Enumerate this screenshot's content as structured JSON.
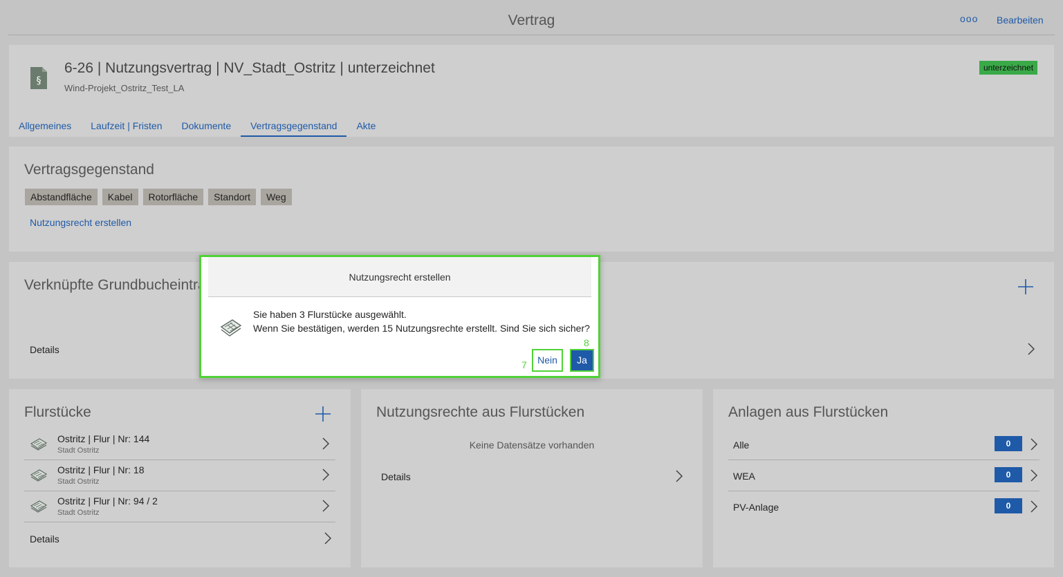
{
  "topbar": {
    "title": "Vertrag",
    "more_label": "ooo",
    "edit_label": "Bearbeiten"
  },
  "header": {
    "title": "6-26 | Nutzungsvertrag | NV_Stadt_Ostritz | unterzeichnet",
    "subtitle": "Wind-Projekt_Ostritz_Test_LA",
    "status_badge": "unterzeichnet",
    "tabs": [
      {
        "label": "Allgemeines",
        "active": false
      },
      {
        "label": "Laufzeit | Fristen",
        "active": false
      },
      {
        "label": "Dokumente",
        "active": false
      },
      {
        "label": "Vertragsgegenstand",
        "active": true
      },
      {
        "label": "Akte",
        "active": false
      }
    ]
  },
  "vertragsgegenstand": {
    "title": "Vertragsgegenstand",
    "chips": [
      "Abstandfläche",
      "Kabel",
      "Rotorfläche",
      "Standort",
      "Weg"
    ],
    "create_link": "Nutzungsrecht erstellen"
  },
  "grundbuch": {
    "title": "Verknüpfte Grundbucheinträ",
    "details_label": "Details"
  },
  "flurstuecke": {
    "title": "Flurstücke",
    "items": [
      {
        "title": "Ostritz | Flur | Nr: 144",
        "sub": "Stadt Ostritz"
      },
      {
        "title": "Ostritz | Flur | Nr: 18",
        "sub": "Stadt Ostritz"
      },
      {
        "title": "Ostritz | Flur | Nr: 94 / 2",
        "sub": "Stadt Ostritz"
      }
    ],
    "details_label": "Details"
  },
  "nutzungsrechte": {
    "title": "Nutzungsrechte aus Flurstücken",
    "empty_text": "Keine Datensätze vorhanden",
    "details_label": "Details"
  },
  "anlagen": {
    "title": "Anlagen aus Flurstücken",
    "items": [
      {
        "label": "Alle",
        "count": "0"
      },
      {
        "label": "WEA",
        "count": "0"
      },
      {
        "label": "PV-Anlage",
        "count": "0"
      }
    ]
  },
  "dialog": {
    "title": "Nutzungsrecht erstellen",
    "line1": "Sie haben 3 Flurstücke ausgewählt.",
    "line2": "Wenn Sie bestätigen, werden 15 Nutzungsrechte erstellt. Sind Sie sich sicher?",
    "no_label": "Nein",
    "yes_label": "Ja",
    "marker_no": "7",
    "marker_yes": "8"
  },
  "colors": {
    "accent": "#1e5aa8",
    "status_green": "#3aaa48",
    "highlight": "#50d236"
  }
}
